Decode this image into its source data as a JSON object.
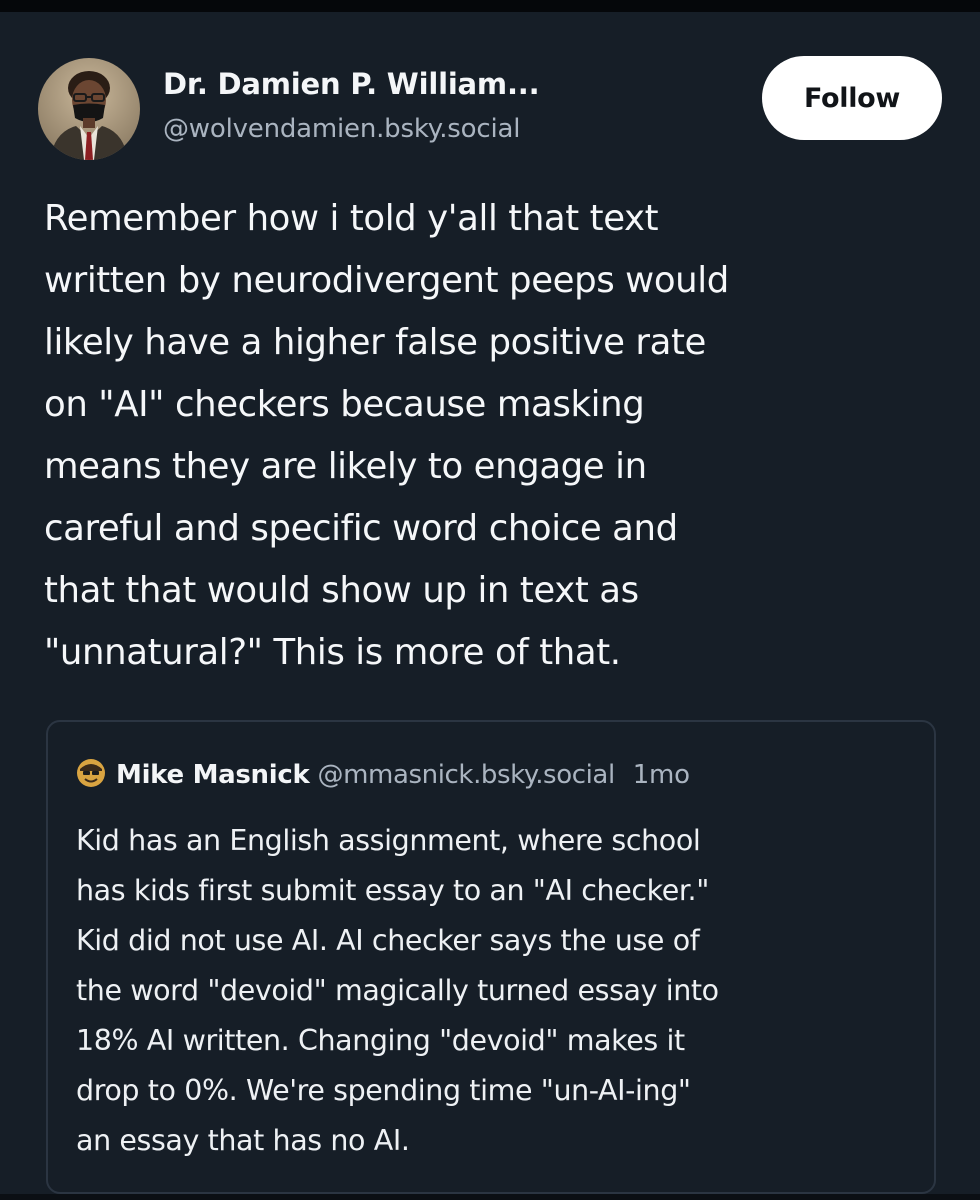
{
  "post": {
    "author": {
      "display_name": "Dr. Damien P. William...",
      "handle": "@wolvendamien.bsky.social",
      "avatar_icon": "profile-photo-avatar"
    },
    "follow_label": "Follow",
    "text": "Remember how i told y'all that text\nwritten by neurodivergent peeps would\nlikely have a higher false positive rate\non \"AI\" checkers because masking\nmeans they are likely to engage in\ncareful and specific word choice and\nthat that would show up in text as\n\"unnatural?\" This is more of that."
  },
  "quote": {
    "author": {
      "display_name": "Mike Masnick",
      "handle": "@mmasnick.bsky.social",
      "avatar_icon": "cartoon-face-avatar"
    },
    "time": "1mo",
    "text": "Kid has an English assignment, where school\nhas kids first submit essay to an \"AI checker.\"\nKid did not use AI. AI checker says the use of\nthe word \"devoid\" magically turned essay into\n18% AI written. Changing \"devoid\" makes it\ndrop to 0%. We're spending time \"un-AI-ing\"\nan essay that has no AI."
  },
  "colors": {
    "background": "#161e27",
    "text": "#f5f7f9",
    "secondary_text": "#aab4c0",
    "follow_button_bg": "#ffffff",
    "quote_border": "#2b3542"
  }
}
